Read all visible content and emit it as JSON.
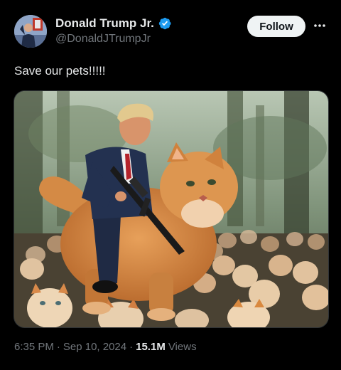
{
  "author": {
    "display_name": "Donald Trump Jr.",
    "handle": "@DonaldJTrumpJr",
    "verified": true,
    "verified_badge_icon": "verified-badge-icon",
    "avatar_icon": "avatar-photo"
  },
  "header": {
    "follow_label": "Follow",
    "more_icon": "more-icon"
  },
  "tweet": {
    "text": "Save our pets!!!!!",
    "media_description_icon": "ai-image"
  },
  "meta": {
    "time": "6:35 PM",
    "separator1": "·",
    "date": "Sep 10, 2024",
    "separator2": "·",
    "views_count": "15.1M",
    "views_label": "Views"
  },
  "colors": {
    "background": "#000000",
    "text_primary": "#e7e9ea",
    "text_secondary": "#71767b",
    "verified_blue": "#1d9bf0",
    "follow_bg": "#eff3f4"
  }
}
